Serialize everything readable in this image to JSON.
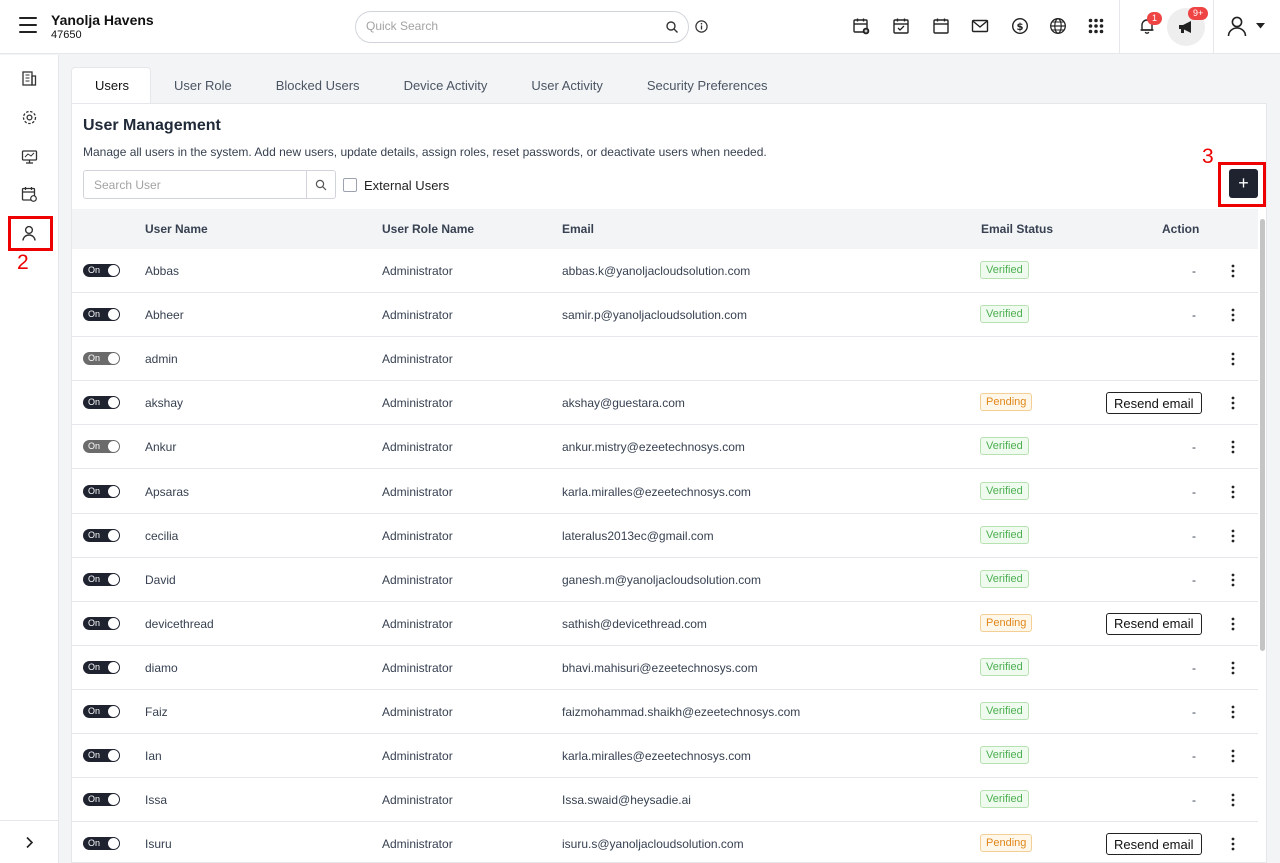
{
  "header": {
    "property_name": "Yanolja Havens",
    "property_id": "47650",
    "search_placeholder": "Quick Search",
    "notification_count": "1",
    "announcement_count": "9+"
  },
  "tabs": [
    "Users",
    "User Role",
    "Blocked Users",
    "Device Activity",
    "User Activity",
    "Security Preferences"
  ],
  "panel": {
    "title": "User Management",
    "description": "Manage all users in the system. Add new users, update details, assign roles, reset passwords, or deactivate users when needed.",
    "search_placeholder": "Search User",
    "external_label": "External Users",
    "add_symbol": "+"
  },
  "annotations": {
    "sidebar_marker": "2",
    "add_marker": "3"
  },
  "table": {
    "headers": [
      "User Name",
      "User Role Name",
      "Email",
      "Email Status",
      "Action"
    ],
    "rows": [
      {
        "toggle": "On",
        "name": "Abbas",
        "role": "Administrator",
        "email": "abbas.k@yanoljacloudsolution.com",
        "status": "Verified",
        "action": "-"
      },
      {
        "toggle": "On",
        "name": "Abheer",
        "role": "Administrator",
        "email": "samir.p@yanoljacloudsolution.com",
        "status": "Verified",
        "action": "-"
      },
      {
        "toggle": "On",
        "name": "admin",
        "role": "Administrator",
        "email": "",
        "status": "",
        "action": ""
      },
      {
        "toggle": "On",
        "name": "akshay",
        "role": "Administrator",
        "email": "akshay@guestara.com",
        "status": "Pending",
        "action": "Resend email"
      },
      {
        "toggle": "On",
        "name": "Ankur",
        "role": "Administrator",
        "email": "ankur.mistry@ezeetechnosys.com",
        "status": "Verified",
        "action": "-"
      },
      {
        "toggle": "On",
        "name": "Apsaras",
        "role": "Administrator",
        "email": "karla.miralles@ezeetechnosys.com",
        "status": "Verified",
        "action": "-"
      },
      {
        "toggle": "On",
        "name": "cecilia",
        "role": "Administrator",
        "email": "lateralus2013ec@gmail.com",
        "status": "Verified",
        "action": "-"
      },
      {
        "toggle": "On",
        "name": "David",
        "role": "Administrator",
        "email": "ganesh.m@yanoljacloudsolution.com",
        "status": "Verified",
        "action": "-"
      },
      {
        "toggle": "On",
        "name": "devicethread",
        "role": "Administrator",
        "email": "sathish@devicethread.com",
        "status": "Pending",
        "action": "Resend email"
      },
      {
        "toggle": "On",
        "name": "diamo",
        "role": "Administrator",
        "email": "bhavi.mahisuri@ezeetechnosys.com",
        "status": "Verified",
        "action": "-"
      },
      {
        "toggle": "On",
        "name": "Faiz",
        "role": "Administrator",
        "email": "faizmohammad.shaikh@ezeetechnosys.com",
        "status": "Verified",
        "action": "-"
      },
      {
        "toggle": "On",
        "name": "Ian",
        "role": "Administrator",
        "email": "karla.miralles@ezeetechnosys.com",
        "status": "Verified",
        "action": "-"
      },
      {
        "toggle": "On",
        "name": "Issa",
        "role": "Administrator",
        "email": "Issa.swaid@heysadie.ai",
        "status": "Verified",
        "action": "-"
      },
      {
        "toggle": "On",
        "name": "Isuru",
        "role": "Administrator",
        "email": "isuru.s@yanoljacloudsolution.com",
        "status": "Pending",
        "action": "Resend email"
      }
    ]
  },
  "sidebar": {
    "items": [
      "building-icon",
      "settings-icon",
      "monitor-icon",
      "calendar-icon",
      "user-icon"
    ]
  },
  "colors": {
    "primary_dark": "#1f2330",
    "highlight": "#ee0000",
    "verified": "#4caf50",
    "pending": "#e0861a",
    "badge": "#ef4444"
  }
}
